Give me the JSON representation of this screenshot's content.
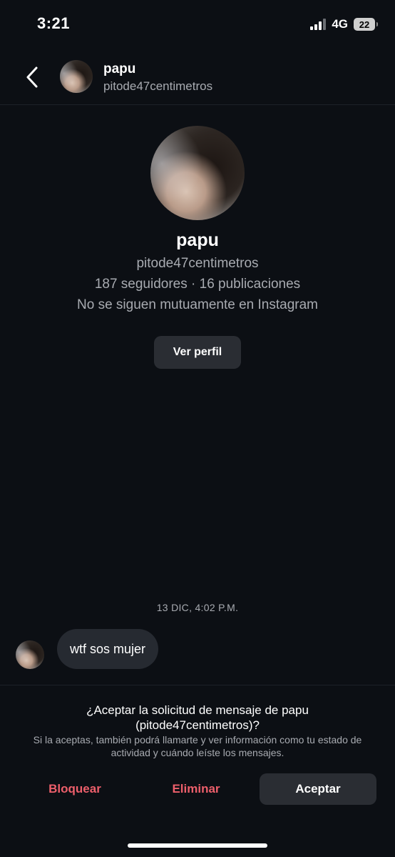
{
  "status_bar": {
    "time": "3:21",
    "network": "4G",
    "battery": "22"
  },
  "header": {
    "name": "papu",
    "username": "pitode47centimetros"
  },
  "profile": {
    "name": "papu",
    "username": "pitode47centimetros",
    "stats": "187 seguidores · 16 publicaciones",
    "mutual": "No se siguen mutuamente en Instagram",
    "view_profile_label": "Ver perfil"
  },
  "thread": {
    "timestamp": "13 DIC, 4:02 P.M.",
    "messages": [
      {
        "text": "wtf sos mujer"
      }
    ]
  },
  "request": {
    "title_line1": "¿Aceptar la solicitud de mensaje de papu",
    "title_line2": "(pitode47centimetros)?",
    "description": "Si la aceptas, también podrá llamarte y ver información como tu estado de actividad y cuándo leíste los mensajes.",
    "block_label": "Bloquear",
    "delete_label": "Eliminar",
    "accept_label": "Aceptar"
  },
  "colors": {
    "background": "#0c0f14",
    "danger": "#ed5f6b",
    "button_bg": "#2a2d33",
    "bubble_bg": "#262a31",
    "secondary_text": "#a8abb1"
  }
}
